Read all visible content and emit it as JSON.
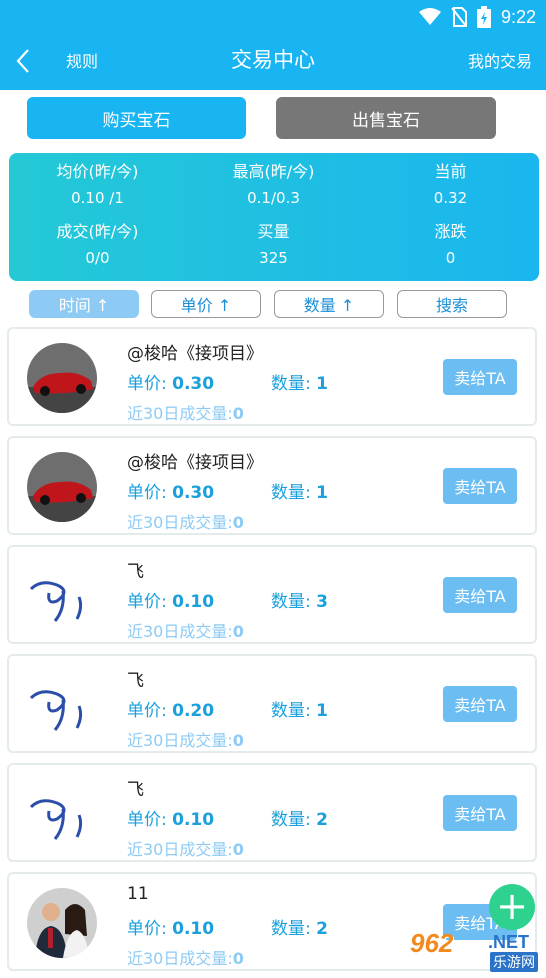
{
  "status": {
    "time": "9:22"
  },
  "nav": {
    "left_label": "规则",
    "title": "交易中心",
    "right_label": "我的交易"
  },
  "tabs": {
    "buy": "购买宝石",
    "sell": "出售宝石"
  },
  "stats": {
    "avg_label": "均价(昨/今)",
    "avg_value": "0.10 /1",
    "high_label": "最高(昨/今)",
    "high_value": "0.1/0.3",
    "current_label": "当前",
    "current_value": "0.32",
    "deal_label": "成交(昨/今)",
    "deal_value": "0/0",
    "buy_volume_label": "买量",
    "buy_volume_value": "325",
    "change_label": "涨跌",
    "change_value": "0"
  },
  "sort": {
    "time": "时间 ↑",
    "price": "单价 ↑",
    "quantity": "数量 ↑",
    "search": "搜索"
  },
  "labels": {
    "price": "单价: ",
    "quantity": "数量: ",
    "recent": "近30日成交量:",
    "sell_button": "卖给TA"
  },
  "orders": [
    {
      "name": "@梭哈《接项目》",
      "price": "0.30",
      "quantity": "1",
      "recent": "0",
      "avatar": "car-avatar"
    },
    {
      "name": "@梭哈《接项目》",
      "price": "0.30",
      "quantity": "1",
      "recent": "0",
      "avatar": "car-avatar"
    },
    {
      "name": "飞",
      "price": "0.10",
      "quantity": "3",
      "recent": "0",
      "avatar": "scribble-avatar"
    },
    {
      "name": "飞",
      "price": "0.20",
      "quantity": "1",
      "recent": "0",
      "avatar": "scribble-avatar"
    },
    {
      "name": "飞",
      "price": "0.10",
      "quantity": "2",
      "recent": "0",
      "avatar": "scribble-avatar"
    },
    {
      "name": "11",
      "price": "0.10",
      "quantity": "2",
      "recent": "0",
      "avatar": "people-avatar"
    }
  ],
  "fab": {
    "icon": "plus-icon"
  },
  "watermark": {
    "num": "962",
    "net": ".NET",
    "cn": "乐游网"
  },
  "colors": {
    "primary": "#19b4f2",
    "sell_tab": "#777777",
    "fab": "#2ed18d"
  }
}
